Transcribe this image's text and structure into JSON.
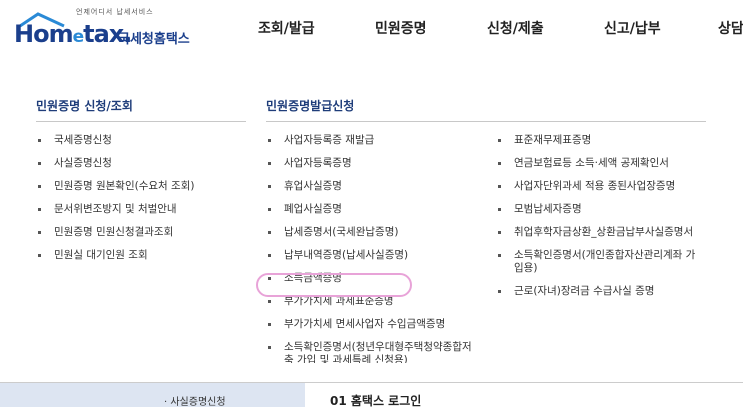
{
  "header": {
    "logo_word": "Hom",
    "logo_e": "e",
    "logo_word2": "tax.",
    "logo_kr": "국세청홈택스",
    "logo_tag": "언제어디서 납세서비스",
    "nav": [
      "조회/발급",
      "민원증명",
      "신청/제출",
      "신고/납부",
      "상담"
    ]
  },
  "menu": {
    "col1": {
      "title": "민원증명 신청/조회",
      "items": [
        "국세증명신청",
        "사실증명신청",
        "민원증명 원본확인(수요처 조회)",
        "문서위변조방지 및 처벌안내",
        "민원증명 민원신청결과조회",
        "민원실 대기인원 조회"
      ]
    },
    "col2": {
      "title": "민원증명발급신청",
      "items": [
        "사업자등록증 재발급",
        "사업자등록증명",
        "휴업사실증명",
        "폐업사실증명",
        "납세증명서(국세완납증명)",
        "납부내역증명(납세사실증명)",
        "소득금액증명",
        "부가가치세 과세표준증명",
        "부가가치세 면세사업자 수입금액증명",
        "소득확인증명서(청년우대형주택청약종합저축 가입 및 과세특례 신청용)"
      ]
    },
    "col3": {
      "items": [
        "표준재무제표증명",
        "연금보험료등 소득·세액 공제확인서",
        "사업자단위과세 적용 종된사업장증명",
        "모범납세자증명",
        "취업후학자금상환_상환금납부사실증명서",
        "소득확인증명서(개인종합자산관리계좌 가입용)",
        "근로(자녀)장려금 수급사실 증명"
      ]
    }
  },
  "bottom": {
    "left_text": "· 사실증명신청",
    "right_text": "01 홈택스 로그인"
  },
  "colors": {
    "brand": "#1b3f8c",
    "highlight": "#e8a3d8"
  }
}
